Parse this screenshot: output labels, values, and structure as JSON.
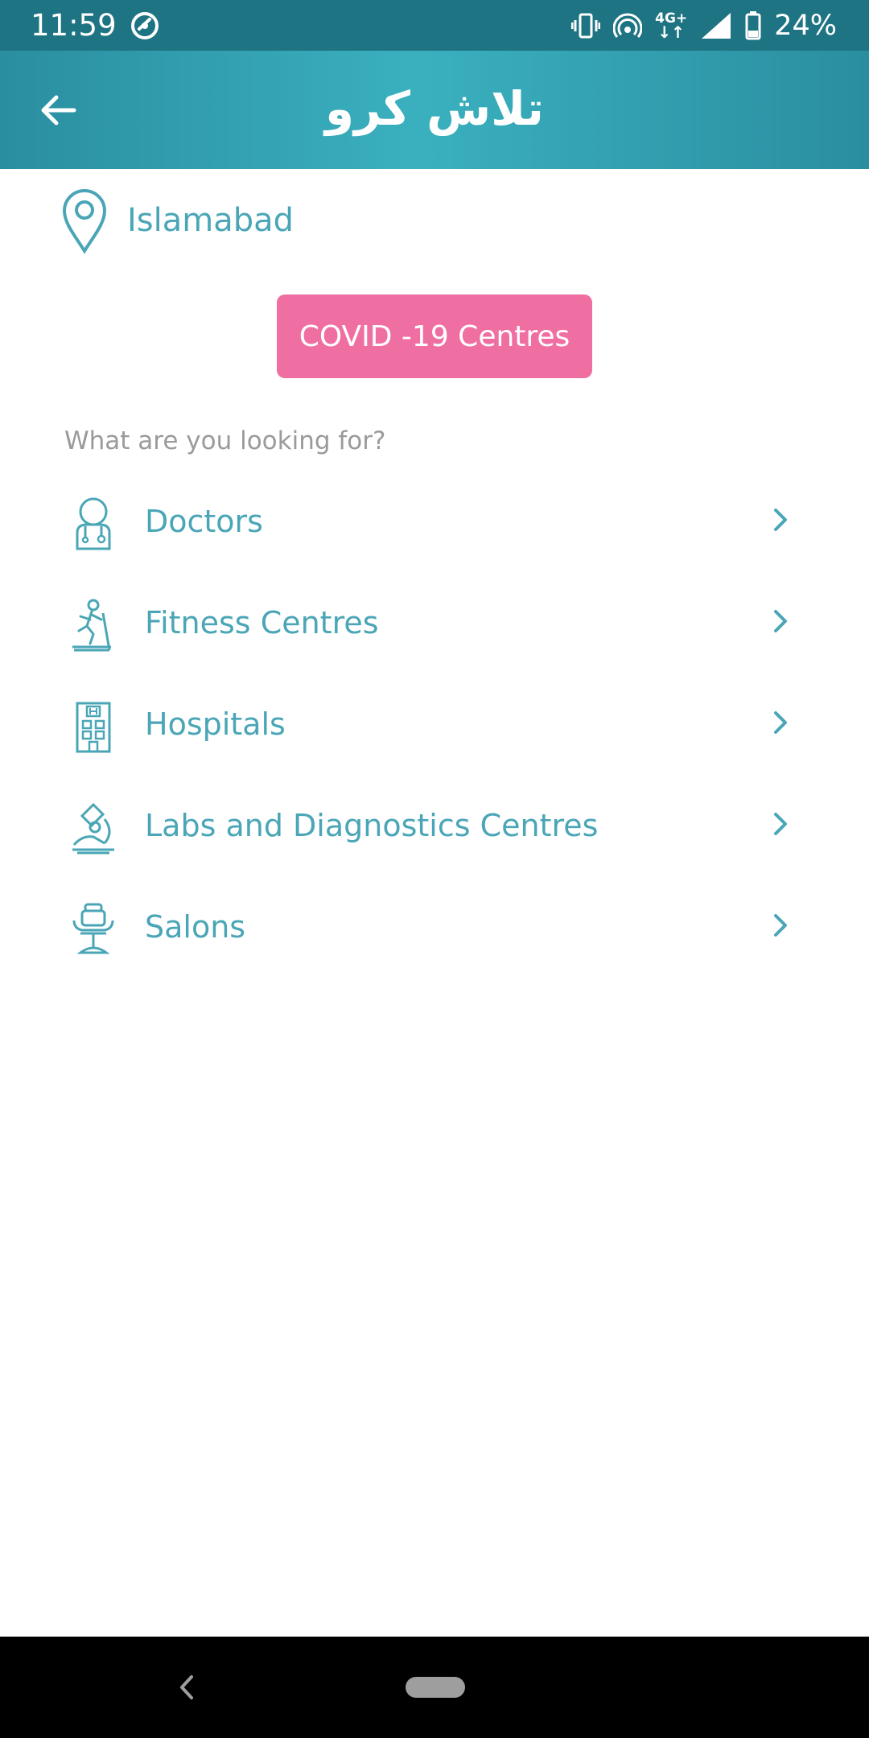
{
  "status_bar": {
    "time": "11:59",
    "network": "4G+",
    "battery": "24%",
    "icons": [
      "sync-icon",
      "vibrate-icon",
      "hotspot-icon",
      "network-4g-icon",
      "signal-icon",
      "battery-icon"
    ]
  },
  "app_bar": {
    "title": "تلاش کرو",
    "back_icon": "arrow-left-icon",
    "background": "#2a8ea0"
  },
  "location": {
    "icon": "location-pin-icon",
    "city": "Islamabad"
  },
  "covid_button": {
    "label": "COVID -19 Centres",
    "color": "#f06fa2"
  },
  "section_label": "What are you looking for?",
  "categories": [
    {
      "label": "Doctors",
      "icon": "doctor-icon"
    },
    {
      "label": "Fitness Centres",
      "icon": "treadmill-icon"
    },
    {
      "label": "Hospitals",
      "icon": "hospital-icon"
    },
    {
      "label": "Labs and Diagnostics Centres",
      "icon": "microscope-icon"
    },
    {
      "label": "Salons",
      "icon": "salon-chair-icon"
    }
  ],
  "colors": {
    "accent": "#4aa6b6",
    "covid": "#f06fa2",
    "muted": "#9a9a9a",
    "status_bar": "#1f7483"
  }
}
